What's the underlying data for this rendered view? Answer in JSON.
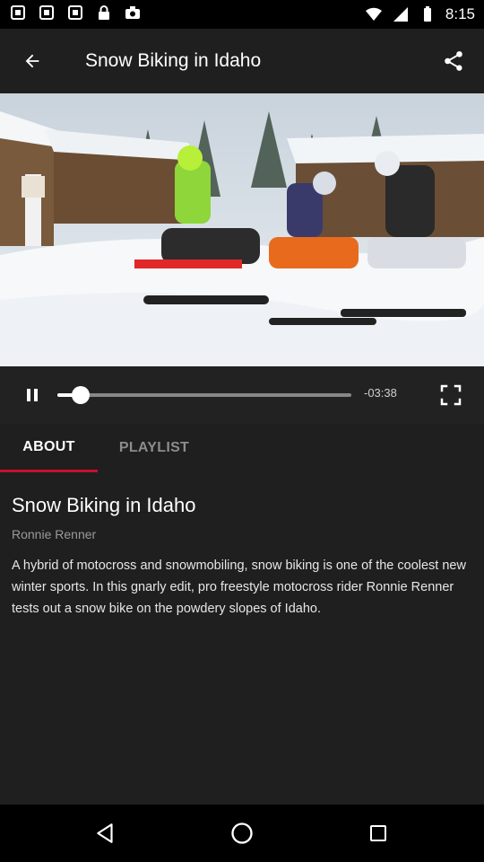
{
  "status_bar": {
    "time": "8:15"
  },
  "app_bar": {
    "title": "Snow Biking in Idaho"
  },
  "player": {
    "time_remaining": "-03:38",
    "progress": 0.08
  },
  "tabs": [
    {
      "label": "ABOUT",
      "active": true
    },
    {
      "label": "PLAYLIST",
      "active": false
    }
  ],
  "video": {
    "title": "Snow Biking in Idaho",
    "author": "Ronnie Renner",
    "description": "A hybrid of motocross and snowmobiling, snow biking is one of the coolest new winter sports. In this gnarly edit, pro freestyle motocross rider Ronnie Renner tests out a snow bike on the powdery slopes of Idaho."
  },
  "colors": {
    "accent": "#c8102e",
    "appbar": "#1f1f1f",
    "controls": "#222222"
  }
}
